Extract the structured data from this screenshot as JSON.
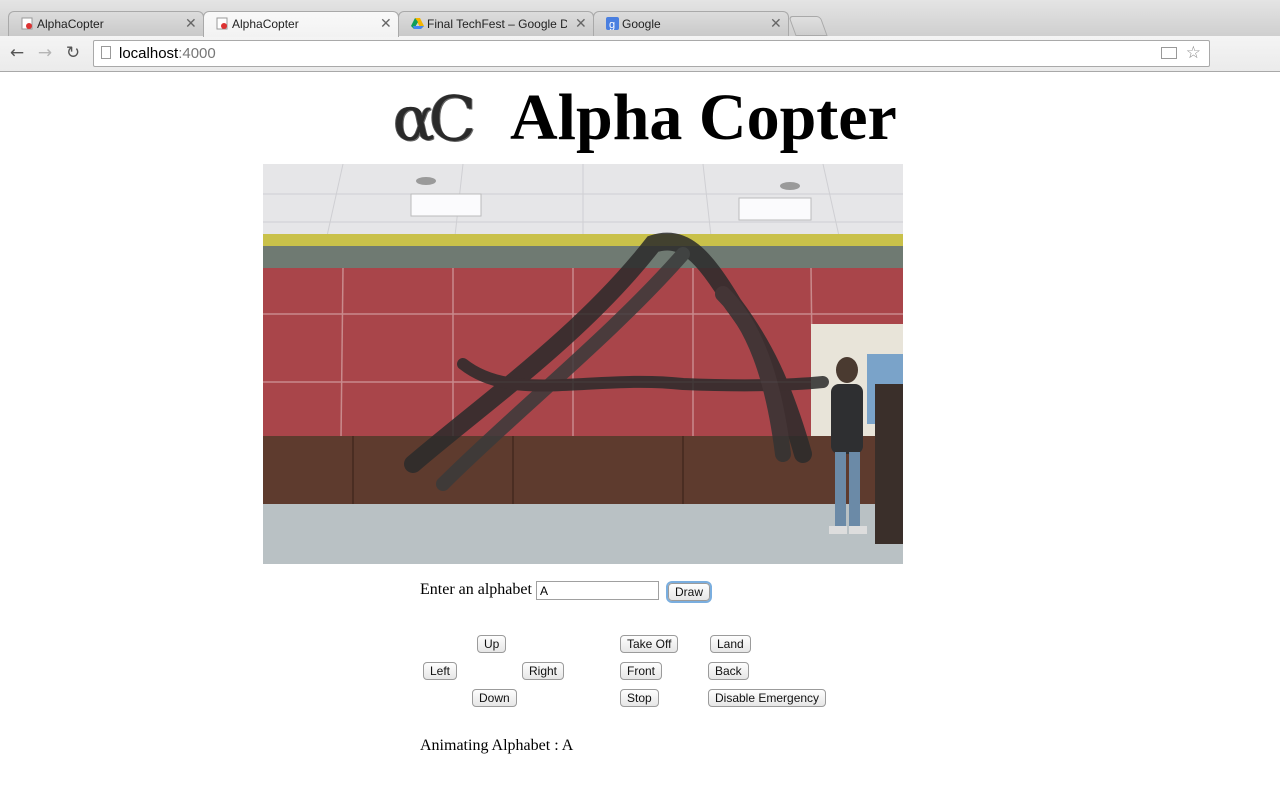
{
  "browser": {
    "tabs": [
      {
        "title": "AlphaCopter",
        "active": false
      },
      {
        "title": "AlphaCopter",
        "active": true
      },
      {
        "title": "Final TechFest – Google Dr",
        "active": false
      },
      {
        "title": "Google",
        "active": false
      }
    ],
    "url_host": "localhost",
    "url_port": ":4000"
  },
  "header": {
    "logo_text": "αC",
    "title": "Alpha Copter"
  },
  "video": {
    "alt": "live camera feed showing drawn letter A"
  },
  "draw_form": {
    "label": "Enter an alphabet",
    "input_value": "A",
    "draw_button": "Draw"
  },
  "controls": {
    "up": "Up",
    "left": "Left",
    "right": "Right",
    "down": "Down",
    "take_off": "Take Off",
    "land": "Land",
    "front": "Front",
    "back": "Back",
    "stop": "Stop",
    "disable_emergency": "Disable Emergency"
  },
  "status": {
    "text": "Animating Alphabet : A"
  },
  "colors": {
    "wall": "#a9454a",
    "floor": "#b9c1c4",
    "ceiling": "#e9e9ea",
    "focus_ring": "#7aaedf"
  }
}
